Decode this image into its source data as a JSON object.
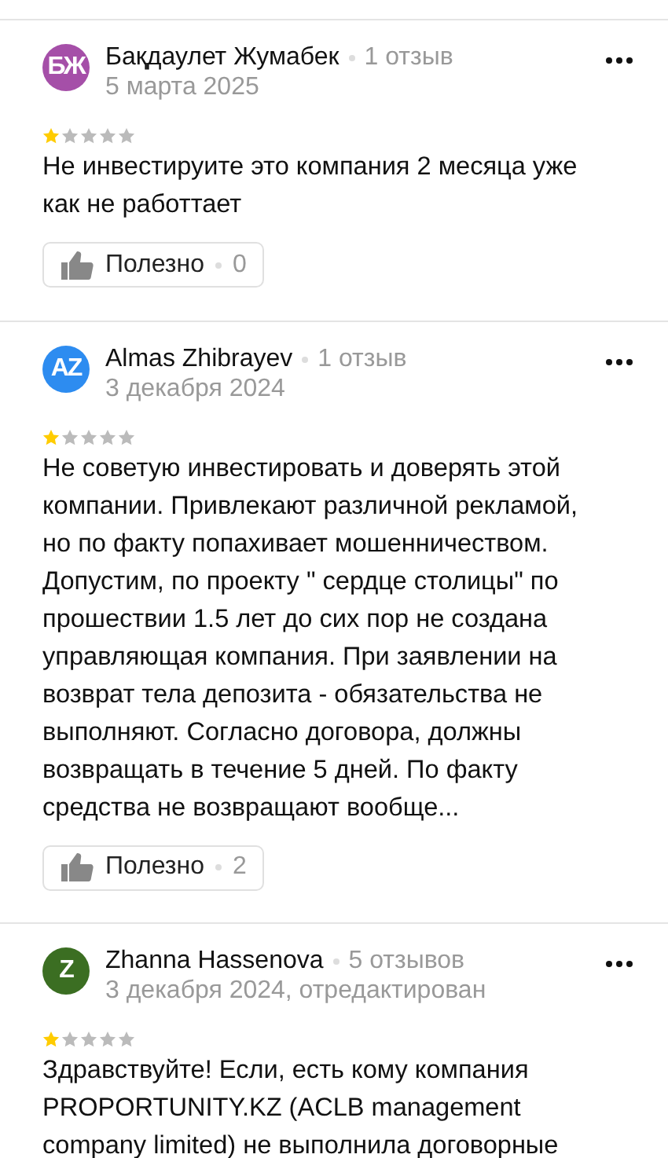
{
  "reviews": [
    {
      "initials": "БЖ",
      "color": "#a54fa8",
      "author": "Бақдаулет Жумабек",
      "review_count": "1 отзыв",
      "date": "5 марта 2025",
      "stars": 1,
      "text": "Не инвестируите это компания 2 месяца уже как не работтает",
      "helpful": {
        "label": "Полезно",
        "count": "0"
      }
    },
    {
      "initials": "AZ",
      "color": "#2d8cf0",
      "author": "Almas Zhibrayev",
      "review_count": "1 отзыв",
      "date": "3 декабря 2024",
      "stars": 1,
      "text": "Не советую инвестировать и доверять этой компании. Привлекают различной рекламой, но по факту попахивает мошенничеством. Допустим, по проекту \" сердце столицы\" по прошествии 1.5 лет до сих пор не создана управляющая компания. При заявлении на возврат тела депозита - обязательства не выполняют. Согласно договора, должны возвращать в течение 5 дней. По факту средства не возвращают вообще...",
      "helpful": {
        "label": "Полезно",
        "count": "2"
      }
    },
    {
      "initials": "Z",
      "color": "#3b6e22",
      "author": "Zhanna Hassenova",
      "review_count": "5 отзывов",
      "date": "3 декабря 2024, отредактирован",
      "stars": 1,
      "text": "Здравствуйте! Если, есть кому компания PROPORTUNITY.KZ (ACLB management company limited) не выполнила договорные"
    }
  ]
}
